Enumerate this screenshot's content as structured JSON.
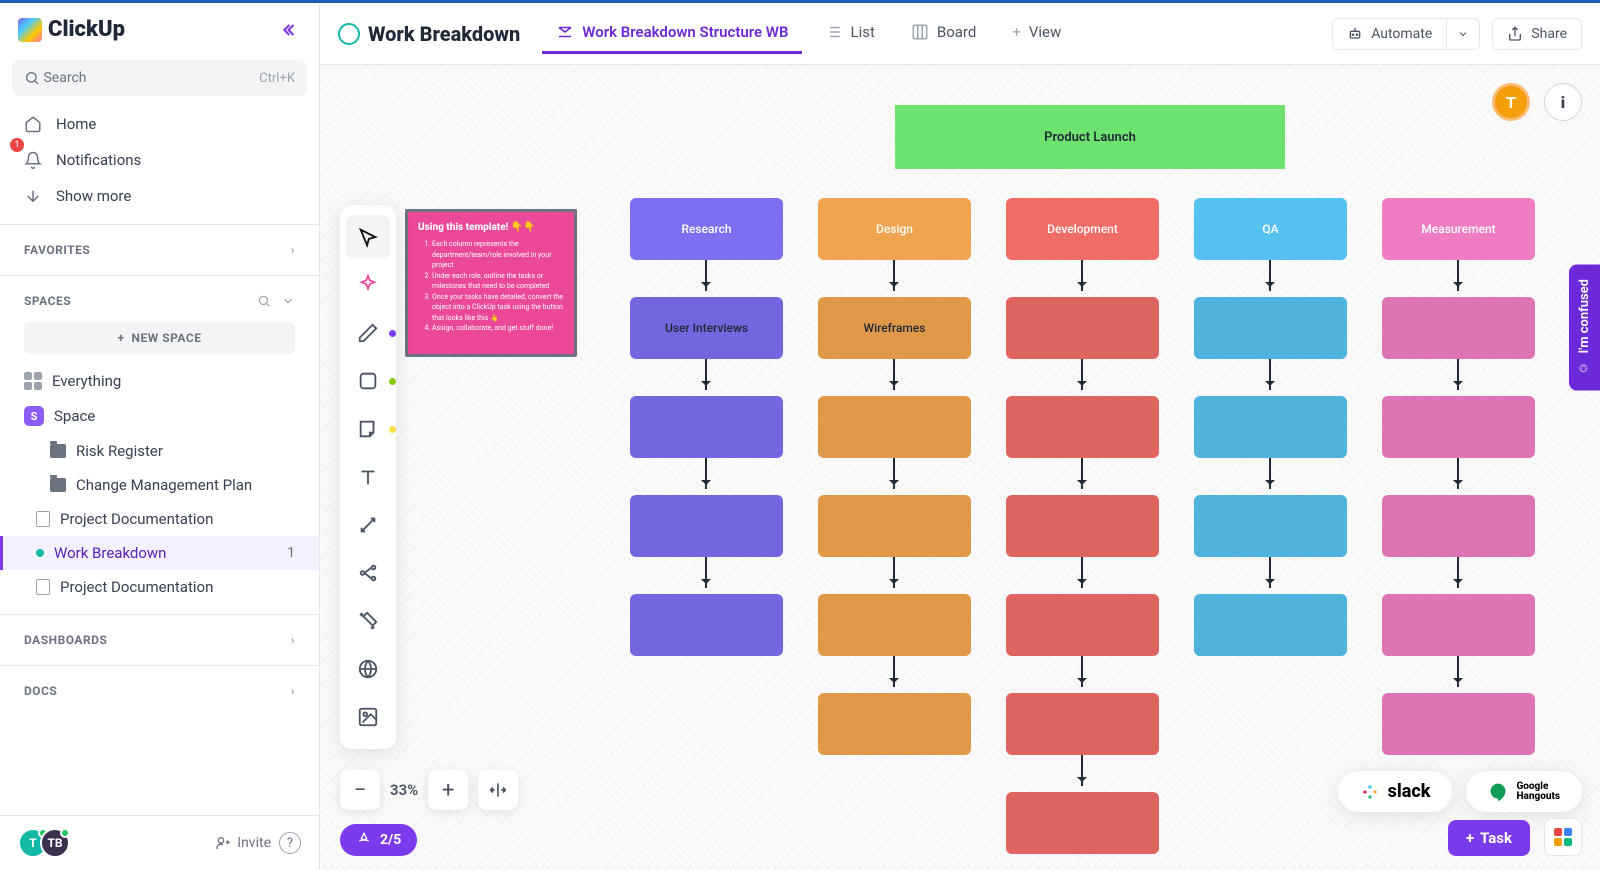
{
  "app_name": "ClickUp",
  "search": {
    "placeholder": "Search",
    "shortcut": "Ctrl+K"
  },
  "nav": {
    "home": "Home",
    "notifications": "Notifications",
    "notif_count": "1",
    "show_more": "Show more"
  },
  "sections": {
    "favorites": "FAVORITES",
    "spaces": "SPACES",
    "dashboards": "DASHBOARDS",
    "docs": "DOCS"
  },
  "new_space": "NEW SPACE",
  "tree": {
    "everything": "Everything",
    "space": "Space",
    "space_letter": "S",
    "risk": "Risk Register",
    "change": "Change Management Plan",
    "pdoc1": "Project Documentation",
    "wb": "Work Breakdown",
    "wb_count": "1",
    "pdoc2": "Project Documentation"
  },
  "footer": {
    "a1": "T",
    "a2": "TB",
    "invite": "Invite"
  },
  "topbar": {
    "title": "Work Breakdown",
    "view1": "Work Breakdown Structure WB",
    "view2": "List",
    "view3": "Board",
    "add_view": "View",
    "automate": "Automate",
    "share": "Share"
  },
  "float": {
    "user": "T",
    "confused": "I'm confused"
  },
  "zoom": {
    "level": "33%"
  },
  "progress": "2/5",
  "chips": {
    "slack": "slack",
    "google": "Google",
    "hangouts": "Hangouts"
  },
  "task": "Task",
  "note": {
    "title": "Using this template! 👇👇",
    "li1": "Each column represents the department/team/role involved in your project",
    "li2": "Under each role, outline the tasks or milestones that need to be completed",
    "li3": "Once your tasks have detailed, convert the object into a ClickUp task using the button that looks like this 👆",
    "li4": "Assign, collaborate, and get stuff done!"
  },
  "wb": {
    "header": "Product Launch",
    "cols": [
      {
        "title": "Research",
        "second": "User Interviews"
      },
      {
        "title": "Design",
        "second": "Wireframes"
      },
      {
        "title": "Development",
        "second": ""
      },
      {
        "title": "QA",
        "second": ""
      },
      {
        "title": "Measurement",
        "second": ""
      }
    ]
  }
}
